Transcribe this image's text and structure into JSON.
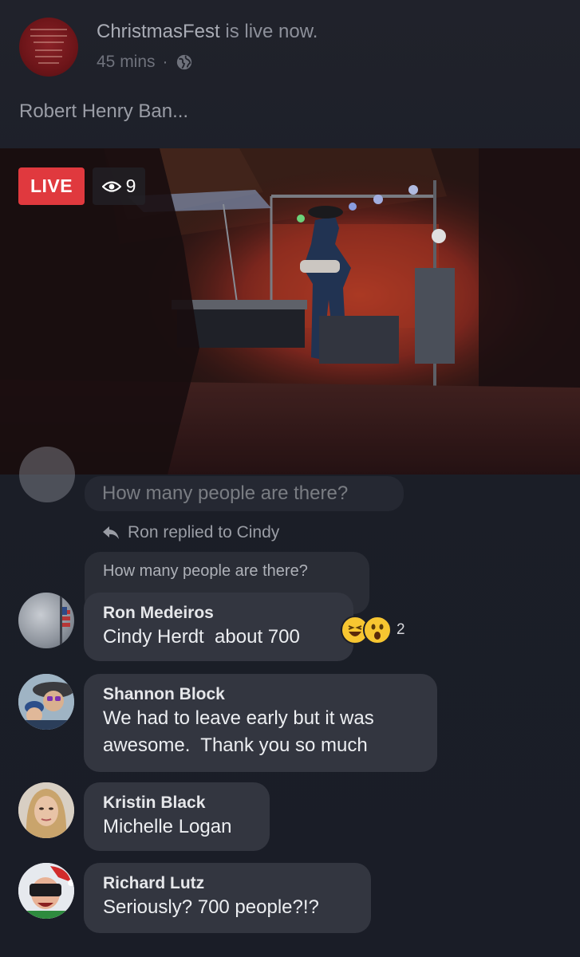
{
  "post": {
    "page_name": "ChristmasFest",
    "status_suffix": " is live now.",
    "time_ago": "45 mins",
    "separator": "·",
    "privacy_icon": "globe-icon",
    "text": "Robert Henry Ban..."
  },
  "video": {
    "live_label": "LIVE",
    "viewer_count": "9",
    "viewer_icon": "eye-icon"
  },
  "comments": {
    "faded_comment": {
      "text": "How many people are there?"
    },
    "reply_indicator": "Ron replied to Cindy",
    "quoted_comment": "How many people are there?",
    "items": [
      {
        "author": "Ron Medeiros",
        "text": "Cindy Herdt  about 700",
        "reactions": {
          "icons": [
            "laughing-emoji-icon",
            "wow-emoji-icon"
          ],
          "count": "2"
        }
      },
      {
        "author": "Shannon Block",
        "text": "We had to leave early but it was\nawesome.  Thank you so much"
      },
      {
        "author": "Kristin Black",
        "text": "Michelle Logan"
      },
      {
        "author": "Richard Lutz",
        "text": "Seriously? 700 people?!?"
      }
    ]
  },
  "colors": {
    "live_red": "#e0393e",
    "bubble_bg": "#333640",
    "page_bg": "#1b1e27"
  }
}
